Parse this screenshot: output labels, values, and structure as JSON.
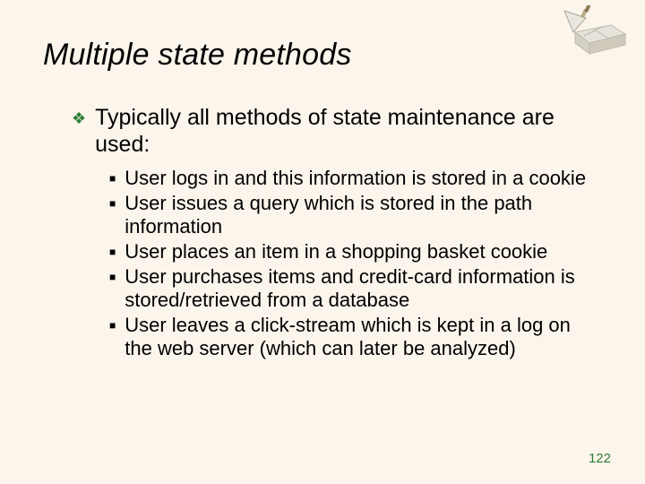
{
  "title": "Multiple state methods",
  "main": "Typically all methods of state maintenance are used:",
  "subs": [
    "User logs in and this information is stored in a cookie",
    "User issues a query which is stored in the path information",
    "User places an item in a shopping basket cookie",
    "User purchases items and credit-card information is stored/retrieved from a database",
    "User leaves a click-stream which is kept in a log on the web server (which can later be analyzed)"
  ],
  "page_number": "122"
}
